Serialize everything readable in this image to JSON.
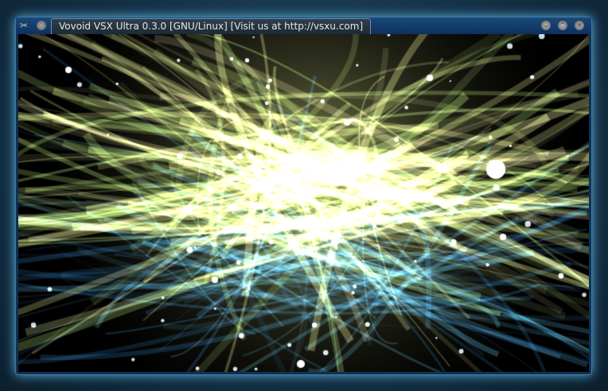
{
  "window": {
    "title": "Vovoid VSX Ultra 0.3.0 [GNU/Linux] [Visit us at http://vsxu.com]",
    "app_icon": "vsxu-logo-icon",
    "buttons": {
      "minimize": "⌄",
      "maximize": "⌃",
      "close": "×"
    }
  },
  "visualization": {
    "colors": [
      "#f4f7a0",
      "#b6e07a",
      "#5fb7d8",
      "#2a6fa6",
      "#d8c8a0"
    ]
  }
}
